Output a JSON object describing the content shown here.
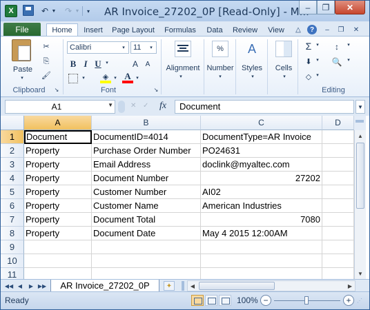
{
  "window": {
    "title": "AR Invoice_27202_0P  [Read-Only]  -  M...",
    "app_icon": "X",
    "minimize": "–",
    "restore": "❐",
    "close": "✕"
  },
  "qat": {
    "undo": "↶",
    "redo": "↷",
    "dropdown": "▼",
    "customize": "▾"
  },
  "tabs": {
    "file": "File",
    "home": "Home",
    "insert": "Insert",
    "page_layout": "Page Layout",
    "formulas": "Formulas",
    "data": "Data",
    "review": "Review",
    "view": "View",
    "help_glyph": "?",
    "minimize_ribbon_glyph": "△",
    "wb_min_glyph": "–",
    "wb_restore_glyph": "❐",
    "wb_close_glyph": "✕"
  },
  "ribbon": {
    "paste_label": "Paste",
    "cut_glyph": "✂",
    "copy_glyph": "⎘",
    "painter_glyph": "🖌",
    "font_name": "Calibri",
    "font_size": "11",
    "bold": "B",
    "italic": "I",
    "underline": "U",
    "grow_font": "A",
    "shrink_font": "A",
    "font_color_glyph": "A",
    "fill_glyph": "◈",
    "launcher": "↘",
    "alignment_label": "Alignment",
    "number_label": "Number",
    "number_glyph": "%",
    "styles_label": "Styles",
    "styles_glyph": "A",
    "cells_label": "Cells",
    "sum_glyph": "Σ",
    "sort_glyph": "↕",
    "fill2_glyph": "⬇",
    "find_glyph": "🔍",
    "clear_glyph": "◇",
    "groups": {
      "clipboard": "Clipboard",
      "font": "Font",
      "editing": "Editing"
    },
    "dropdown": "▾"
  },
  "formula_bar": {
    "name_box": "A1",
    "name_dd": "▼",
    "cancel": "✕",
    "enter": "✓",
    "fx": "fx",
    "value": "Document",
    "expand": "▼"
  },
  "sheet": {
    "columns": [
      "A",
      "B",
      "C",
      "D"
    ],
    "rows": [
      {
        "num": "1",
        "a": "Document",
        "b": "DocumentID=4014",
        "c": "DocumentType=AR Invoice",
        "c_num": false
      },
      {
        "num": "2",
        "a": "Property",
        "b": "Purchase Order Number",
        "c": "PO24631",
        "c_num": false
      },
      {
        "num": "3",
        "a": "Property",
        "b": "Email Address",
        "c": "doclink@myaltec.com",
        "c_num": false
      },
      {
        "num": "4",
        "a": "Property",
        "b": "Document Number",
        "c": "27202",
        "c_num": true
      },
      {
        "num": "5",
        "a": "Property",
        "b": "Customer Number",
        "c": "AI02",
        "c_num": false
      },
      {
        "num": "6",
        "a": "Property",
        "b": "Customer Name",
        "c": "American Industries",
        "c_num": false
      },
      {
        "num": "7",
        "a": "Property",
        "b": "Document Total",
        "c": "7080",
        "c_num": true
      },
      {
        "num": "8",
        "a": "Property",
        "b": "Document Date",
        "c": "May  4 2015 12:00AM",
        "c_num": false
      },
      {
        "num": "9",
        "a": "",
        "b": "",
        "c": "",
        "c_num": false
      },
      {
        "num": "10",
        "a": "",
        "b": "",
        "c": "",
        "c_num": false
      },
      {
        "num": "11",
        "a": "",
        "b": "",
        "c": "",
        "c_num": false
      }
    ],
    "tab_name": "AR Invoice_27202_0P",
    "nav_first": "◀◀",
    "nav_prev": "◀",
    "nav_next": "▶",
    "nav_last": "▶▶",
    "new_sheet_glyph": "✦",
    "scroll_up": "▲",
    "scroll_down": "▼",
    "scroll_left": "◀",
    "scroll_right": "▶"
  },
  "status": {
    "ready": "Ready",
    "zoom": "100%",
    "zoom_out": "−",
    "zoom_in": "+",
    "grip": "⋰"
  }
}
